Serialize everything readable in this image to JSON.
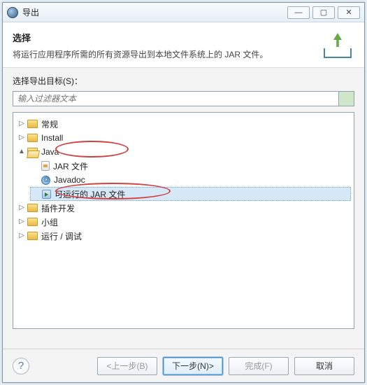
{
  "window": {
    "title": "导出"
  },
  "header": {
    "title": "选择",
    "desc": "将运行应用程序所需的所有资源导出到本地文件系统上的 JAR 文件。"
  },
  "body": {
    "target_label": "选择导出目标(S)：",
    "filter_placeholder": "输入过滤器文本"
  },
  "tree": {
    "items": [
      {
        "label": "常规",
        "expanded": false
      },
      {
        "label": "Install",
        "expanded": false
      },
      {
        "label": "Java",
        "expanded": true,
        "children": [
          {
            "label": "JAR 文件",
            "icon": "jar"
          },
          {
            "label": "Javadoc",
            "icon": "javadoc"
          },
          {
            "label": "可运行的 JAR 文件",
            "icon": "runjar",
            "selected": true
          }
        ]
      },
      {
        "label": "插件开发",
        "expanded": false
      },
      {
        "label": "小组",
        "expanded": false
      },
      {
        "label": "运行 / 调试",
        "expanded": false
      }
    ]
  },
  "buttons": {
    "back": "<上一步(B)",
    "next": "下一步(N)>",
    "finish": "完成(F)",
    "cancel": "取消",
    "help": "?"
  }
}
